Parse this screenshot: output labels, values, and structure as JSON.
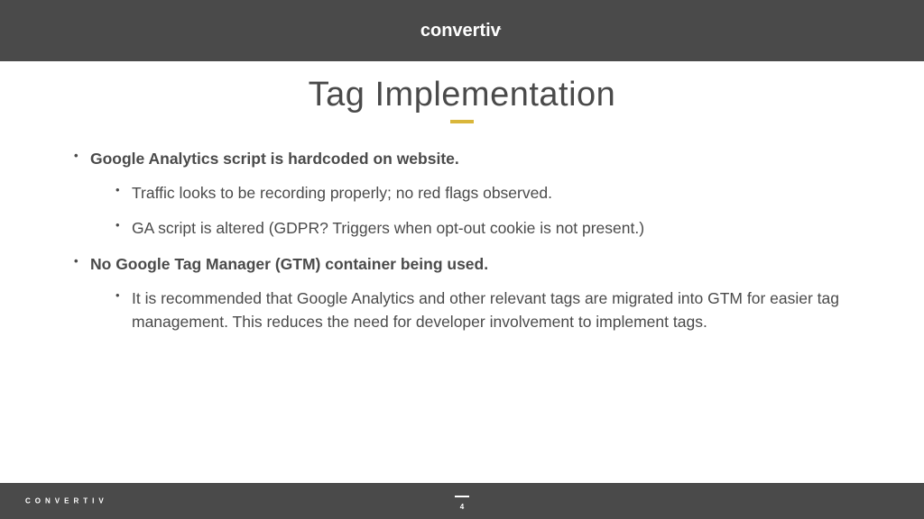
{
  "header": {
    "logo": "convertiv"
  },
  "title": "Tag Implementation",
  "bullets": [
    {
      "text": "Google Analytics script is hardcoded on website.",
      "children": [
        "Traffic looks to be recording properly; no red flags observed.",
        "GA script is altered (GDPR? Triggers when opt-out cookie is not present.)"
      ]
    },
    {
      "text": "No Google Tag Manager (GTM) container being used.",
      "children": [
        "It is recommended that Google Analytics and other relevant tags are migrated into GTM for easier tag management. This reduces the need for developer involvement to implement tags."
      ]
    }
  ],
  "footer": {
    "brand": "CONVERTIV",
    "page": "4"
  }
}
